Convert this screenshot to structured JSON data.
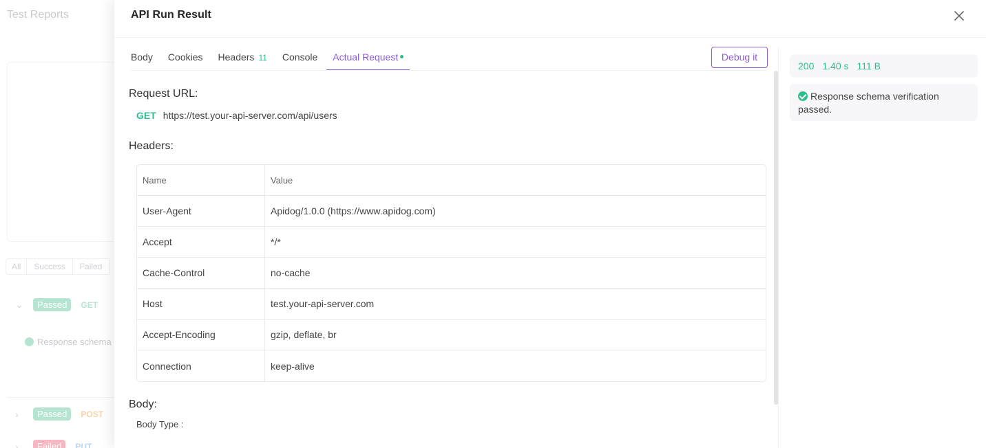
{
  "background": {
    "title": "Test Reports",
    "filters": [
      "All",
      "Success",
      "Failed"
    ],
    "rows": [
      {
        "status": "Passed",
        "method": "GET",
        "status_color": "#b5e5d0",
        "method_color": "#b5e5d0"
      },
      {
        "status": "Passed",
        "method": "POST",
        "status_color": "#b5e5d0",
        "method_color": "#f5d5a8"
      },
      {
        "status": "Failed",
        "method": "PUT",
        "status_color": "#f5b8c0",
        "method_color": "#b8d6f5"
      }
    ],
    "response_snippet": "Response schema"
  },
  "drawer": {
    "title": "API Run Result",
    "close_icon": "close-icon"
  },
  "tabs": [
    {
      "label": "Body"
    },
    {
      "label": "Cookies"
    },
    {
      "label": "Headers",
      "count": "11"
    },
    {
      "label": "Console"
    },
    {
      "label": "Actual Request",
      "active": true
    }
  ],
  "debug_button": "Debug it",
  "request": {
    "url_label": "Request URL:",
    "method": "GET",
    "url": "https://test.your-api-server.com/api/users"
  },
  "headers_section": {
    "title": "Headers:",
    "columns": [
      "Name",
      "Value"
    ],
    "rows": [
      {
        "name": "User-Agent",
        "value": "Apidog/1.0.0 (https://www.apidog.com)"
      },
      {
        "name": "Accept",
        "value": "*/*"
      },
      {
        "name": "Cache-Control",
        "value": "no-cache"
      },
      {
        "name": "Host",
        "value": "test.your-api-server.com"
      },
      {
        "name": "Accept-Encoding",
        "value": "gzip, deflate, br"
      },
      {
        "name": "Connection",
        "value": "keep-alive"
      }
    ]
  },
  "body_section": {
    "title": "Body:",
    "type_label": "Body Type :"
  },
  "side": {
    "status_code": "200",
    "time": "1.40 s",
    "size": "111 B",
    "schema_message": "Response schema verification passed."
  },
  "colors": {
    "accent": "#8b5cd6",
    "success": "#2bbf8a"
  }
}
